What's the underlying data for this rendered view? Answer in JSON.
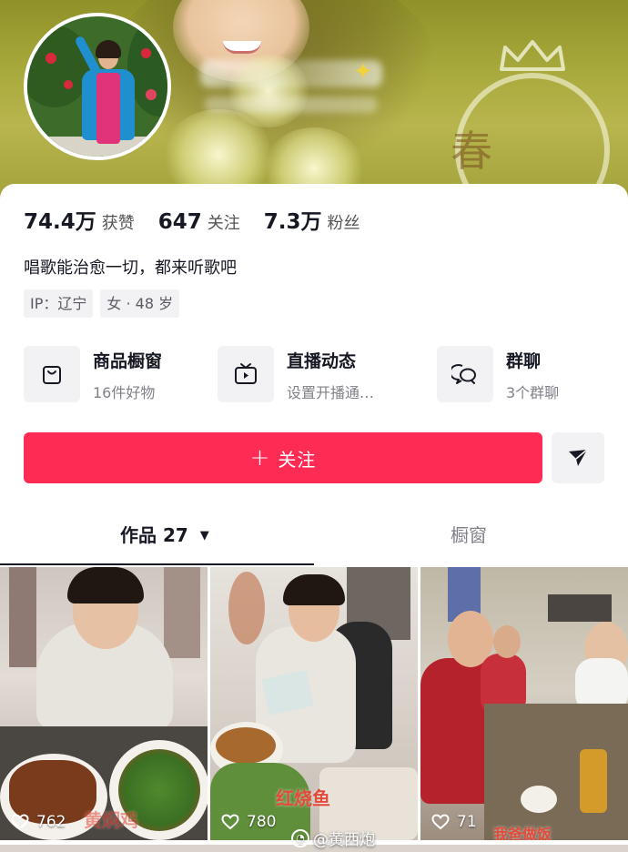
{
  "profile": {
    "stats": [
      {
        "value": "74.4万",
        "label": "获赞"
      },
      {
        "value": "647",
        "label": "关注"
      },
      {
        "value": "7.3万",
        "label": "粉丝"
      }
    ],
    "bio": "唱歌能治愈一切，都来听歌吧",
    "tags": [
      "IP：辽宁",
      "女 · 48 岁"
    ],
    "banner_art_text": "春 青"
  },
  "features": [
    {
      "title": "商品橱窗",
      "subtitle": "16件好物",
      "icon": "shopping-bag-icon"
    },
    {
      "title": "直播动态",
      "subtitle": "设置开播通…",
      "icon": "live-tv-icon"
    },
    {
      "title": "群聊",
      "subtitle": "3个群聊",
      "icon": "group-chat-icon"
    }
  ],
  "actions": {
    "follow_label": "关注",
    "follow_plus": "+",
    "follow_color": "#fe2c55",
    "share_icon": "send-icon"
  },
  "tabs": {
    "works_label": "作品",
    "works_count": "27",
    "works_caret": "▼",
    "showcase_label": "橱窗"
  },
  "videos": [
    {
      "likes": "762",
      "overlay": "黄焖鸡"
    },
    {
      "likes": "780",
      "overlay": "红烧鱼"
    },
    {
      "likes": "71",
      "overlay": "我爸做饭"
    }
  ],
  "watermark": {
    "text": "@黄西炮",
    "icon": "weibo-icon"
  }
}
